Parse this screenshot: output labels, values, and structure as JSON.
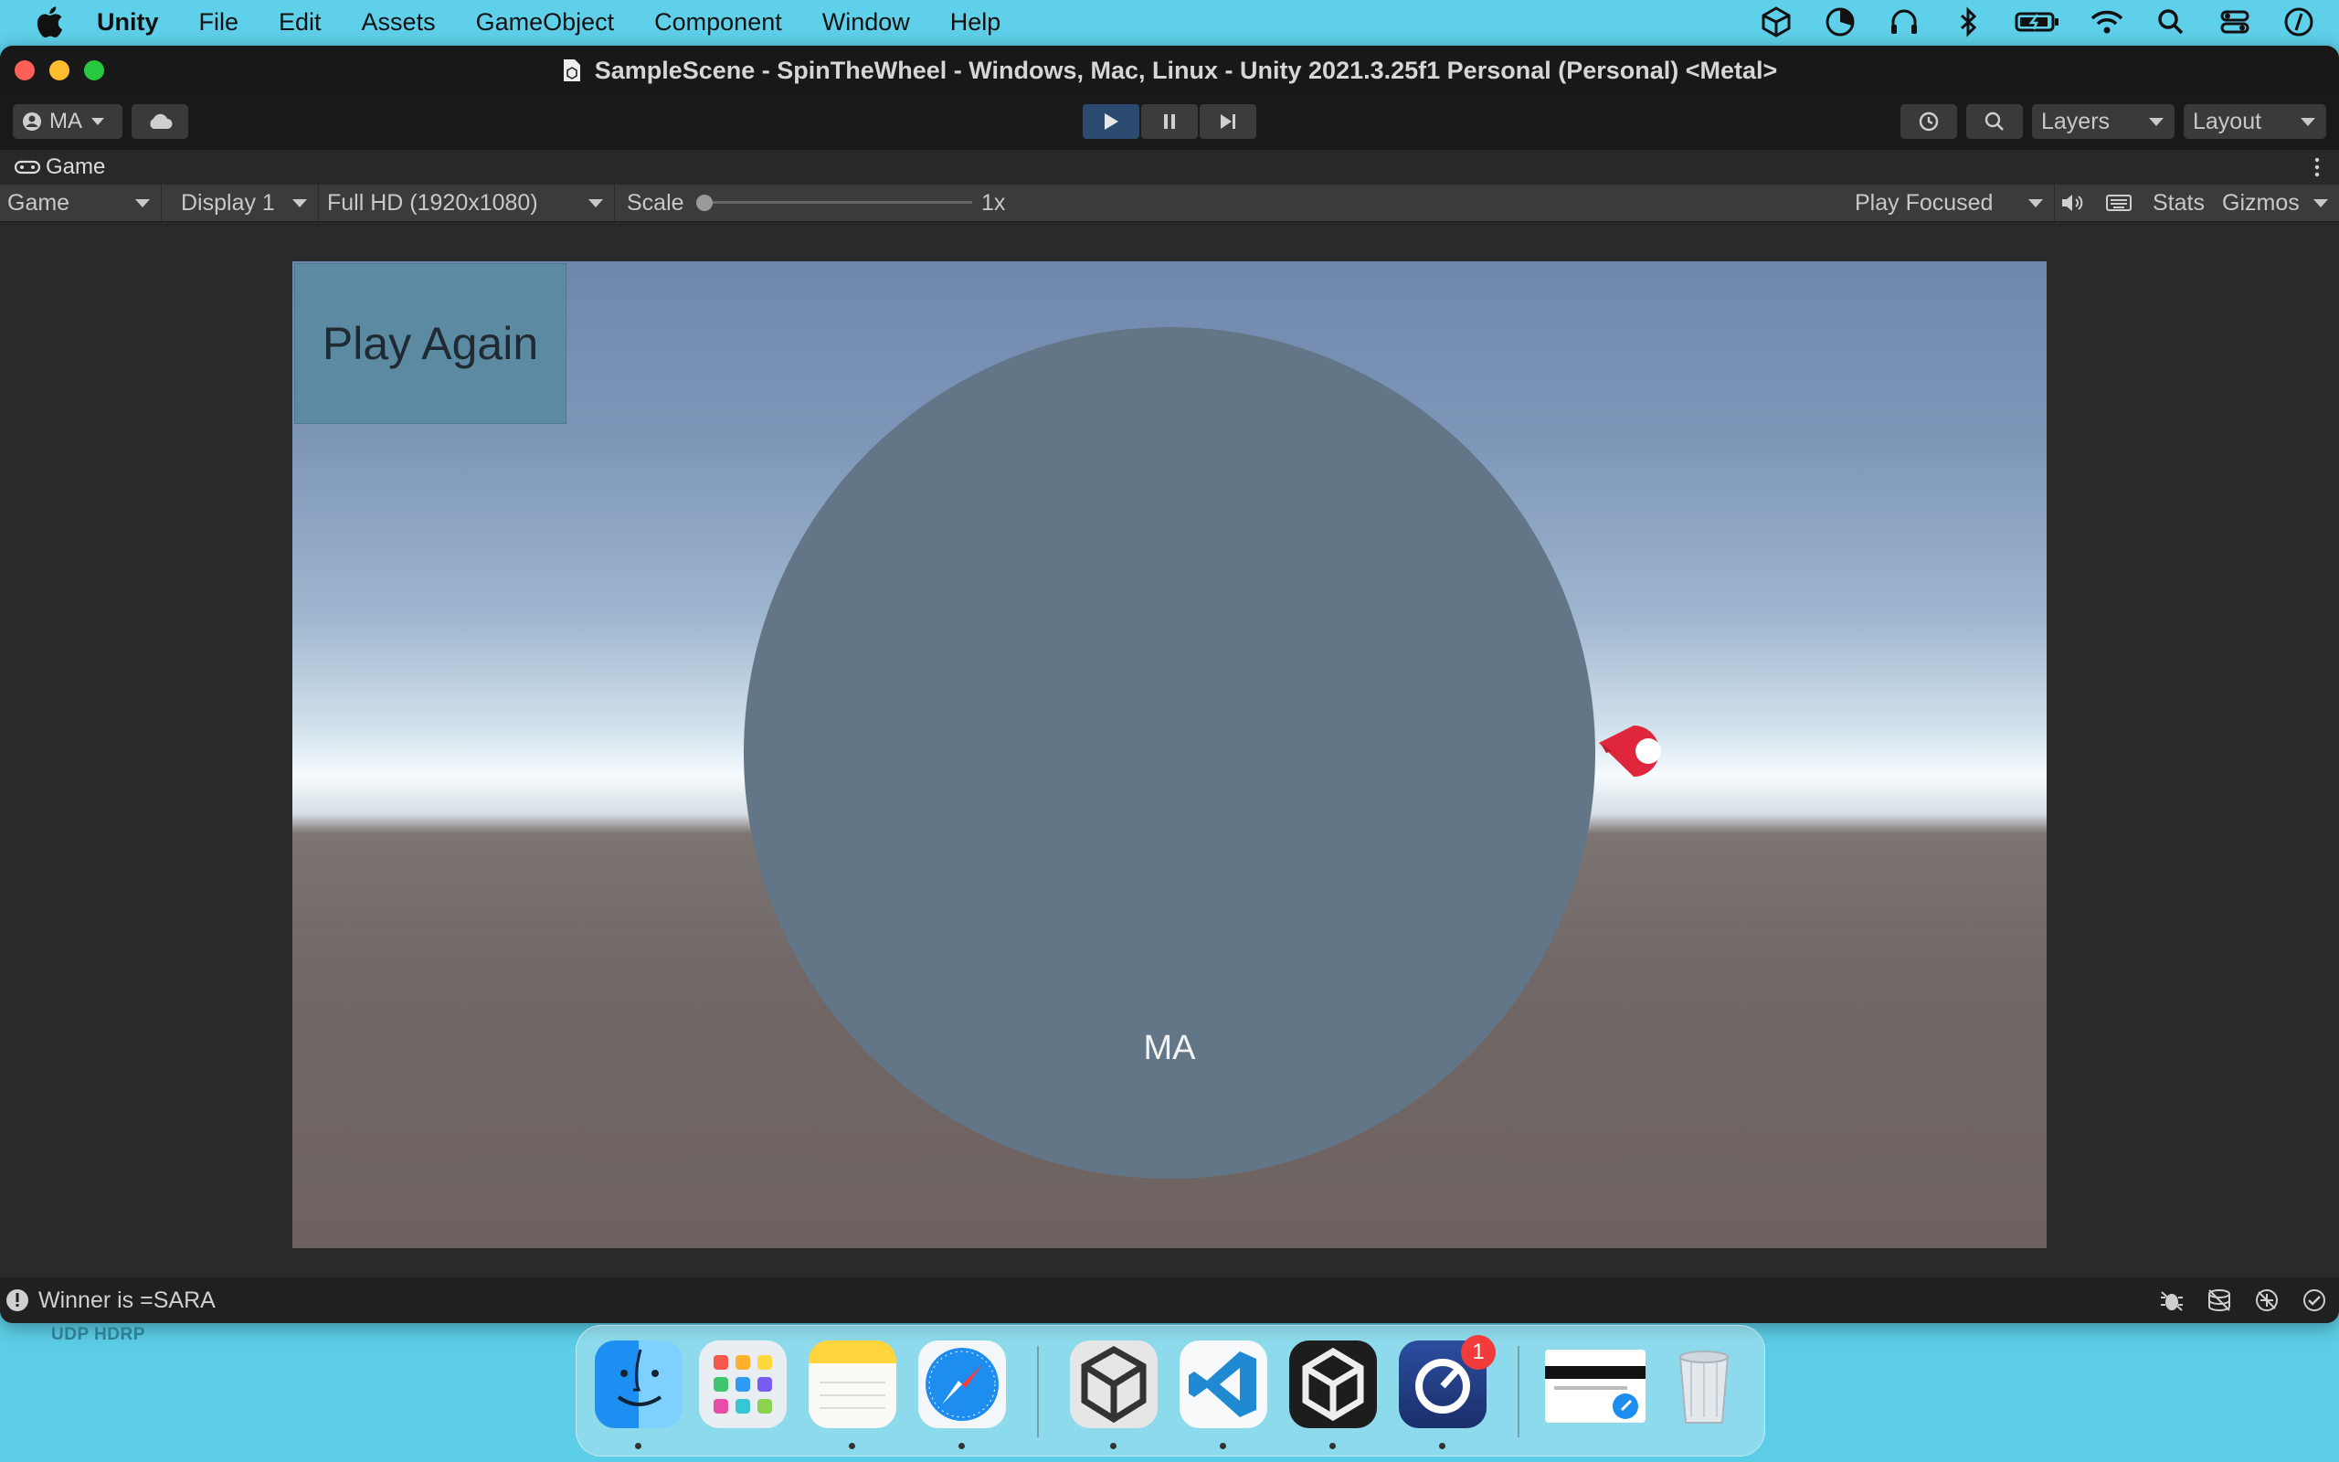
{
  "menubar": {
    "app_name": "Unity",
    "items": [
      "File",
      "Edit",
      "Assets",
      "GameObject",
      "Component",
      "Window",
      "Help"
    ]
  },
  "window": {
    "title": "SampleScene - SpinTheWheel - Windows, Mac, Linux - Unity 2021.3.25f1 Personal (Personal) <Metal>"
  },
  "toolbar": {
    "account": "MA",
    "layers": "Layers",
    "layout": "Layout"
  },
  "game_tab": {
    "label": "Game"
  },
  "game_bar": {
    "view": "Game",
    "display": "Display 1",
    "resolution": "Full HD (1920x1080)",
    "scale_label": "Scale",
    "scale_value": "1x",
    "play_mode": "Play Focused",
    "stats": "Stats",
    "gizmos": "Gizmos"
  },
  "game": {
    "play_again": "Play Again",
    "wheel_label": "MA"
  },
  "status": {
    "message": "Winner is =SARA"
  },
  "desktop": {
    "label": "UDP HDRP"
  },
  "dock": {
    "badge_count": "1"
  },
  "colors": {
    "accent_play": "#2a4a70",
    "wheel": "#627687",
    "button": "#5d8aa3",
    "pointer": "#e0263d"
  }
}
